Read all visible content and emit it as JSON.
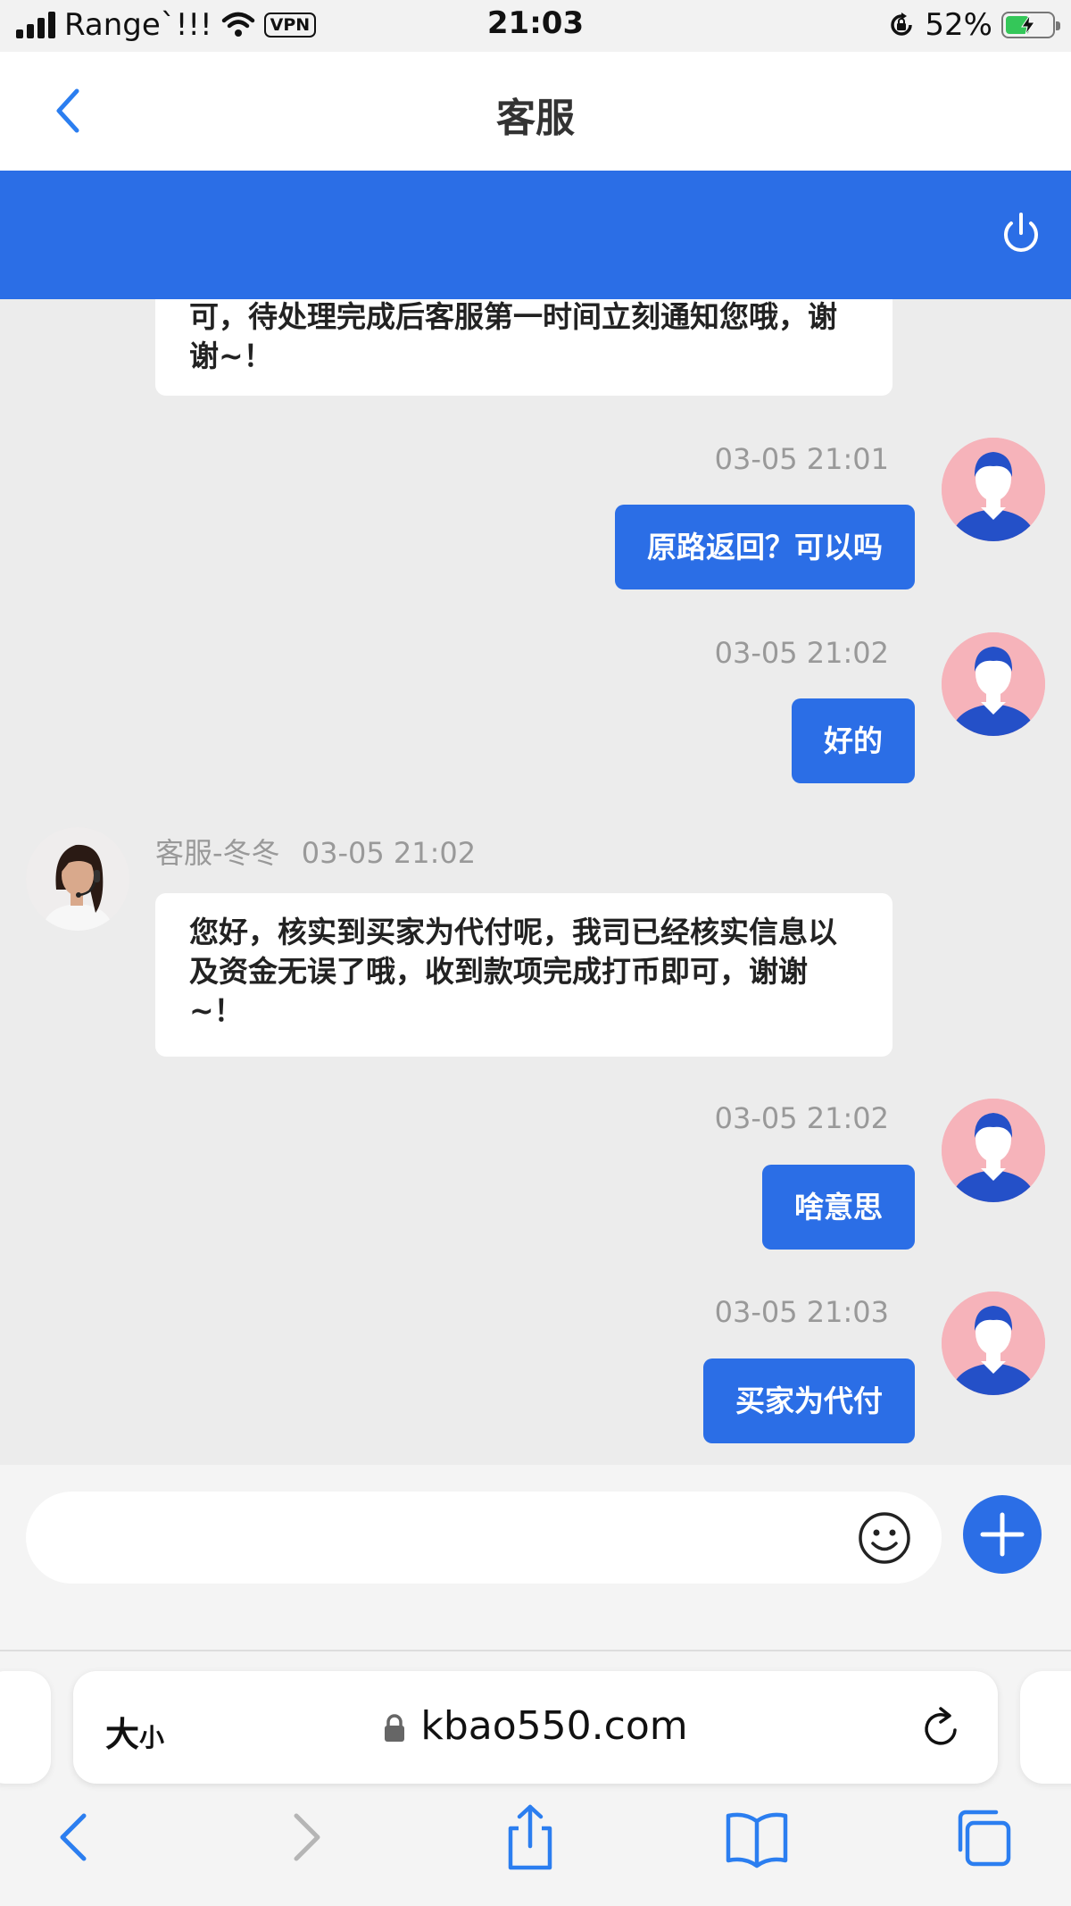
{
  "status_bar": {
    "carrier": "Range`!!!",
    "vpn": "VPN",
    "time": "21:03",
    "battery_percent": "52%",
    "battery_level": 0.52
  },
  "nav": {
    "title": "客服"
  },
  "messages": {
    "m1": {
      "text": "可，待处理完成后客服第一时间立刻通知您哦，谢谢~！"
    },
    "m2": {
      "time": "03-05 21:01",
      "text": "原路返回？可以吗"
    },
    "m3": {
      "time": "03-05 21:02",
      "text": "好的"
    },
    "m4": {
      "sender": "客服-冬冬",
      "time": "03-05 21:02",
      "text": "您好，核实到买家为代付呢，我司已经核实信息以及资金无误了哦，收到款项完成打币即可，谢谢~！"
    },
    "m5": {
      "time": "03-05 21:02",
      "text": "啥意思"
    },
    "m6": {
      "time": "03-05 21:03",
      "text": "买家为代付"
    }
  },
  "input": {
    "placeholder": ""
  },
  "browser": {
    "text_size_big": "大",
    "text_size_small": "小",
    "url": "kbao550.com"
  },
  "colors": {
    "accent": "#2b6ee6",
    "user_avatar_bg": "#f6b3ba"
  }
}
